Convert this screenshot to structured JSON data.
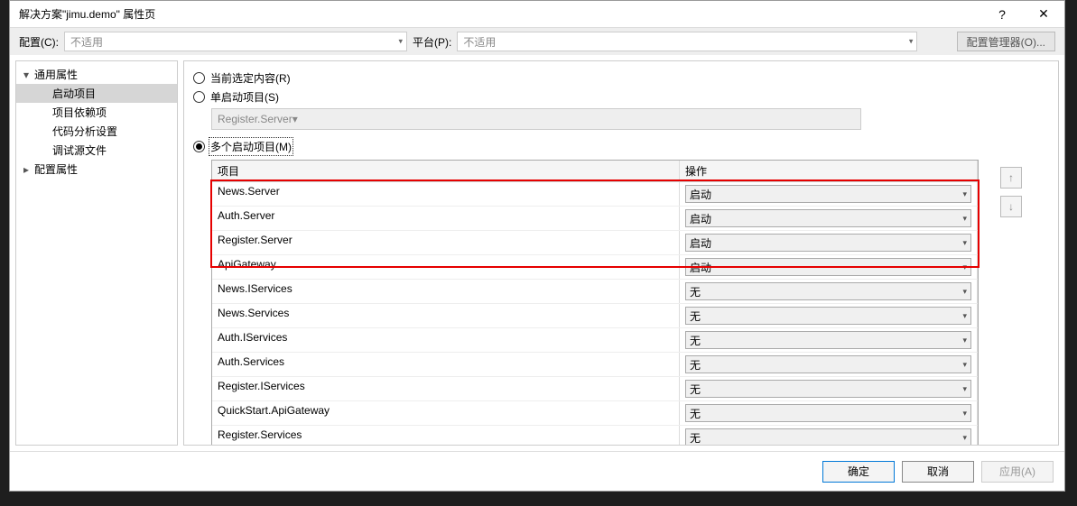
{
  "title": "解决方案\"jimu.demo\" 属性页",
  "titlebar": {
    "help": "?",
    "close": "✕"
  },
  "topbar": {
    "config_label": "配置(C):",
    "config_value": "不适用",
    "platform_label": "平台(P):",
    "platform_value": "不适用",
    "cfg_mgr": "配置管理器(O)..."
  },
  "tree": {
    "items": [
      {
        "label": "通用属性",
        "type": "parent",
        "expanded": true
      },
      {
        "label": "启动项目",
        "type": "child",
        "selected": true
      },
      {
        "label": "项目依赖项",
        "type": "child"
      },
      {
        "label": "代码分析设置",
        "type": "child"
      },
      {
        "label": "调试源文件",
        "type": "child"
      },
      {
        "label": "配置属性",
        "type": "parent",
        "expanded": false
      }
    ]
  },
  "radios": {
    "current": "当前选定内容(R)",
    "single": "单启动项目(S)",
    "multi": "多个启动项目(M)"
  },
  "single_value": "Register.Server",
  "table": {
    "headers": {
      "project": "项目",
      "action": "操作"
    },
    "rows": [
      {
        "project": "News.Server",
        "action": "启动",
        "hl": true
      },
      {
        "project": "Auth.Server",
        "action": "启动",
        "hl": true
      },
      {
        "project": "Register.Server",
        "action": "启动",
        "hl": true
      },
      {
        "project": "ApiGateway",
        "action": "启动",
        "hl": true
      },
      {
        "project": "News.IServices",
        "action": "无"
      },
      {
        "project": "News.Services",
        "action": "无"
      },
      {
        "project": "Auth.IServices",
        "action": "无"
      },
      {
        "project": "Auth.Services",
        "action": "无"
      },
      {
        "project": "Register.IServices",
        "action": "无"
      },
      {
        "project": "QuickStart.ApiGateway",
        "action": "无"
      },
      {
        "project": "Register.Services",
        "action": "无"
      }
    ]
  },
  "footer": {
    "ok": "确定",
    "cancel": "取消",
    "apply": "应用(A)"
  }
}
